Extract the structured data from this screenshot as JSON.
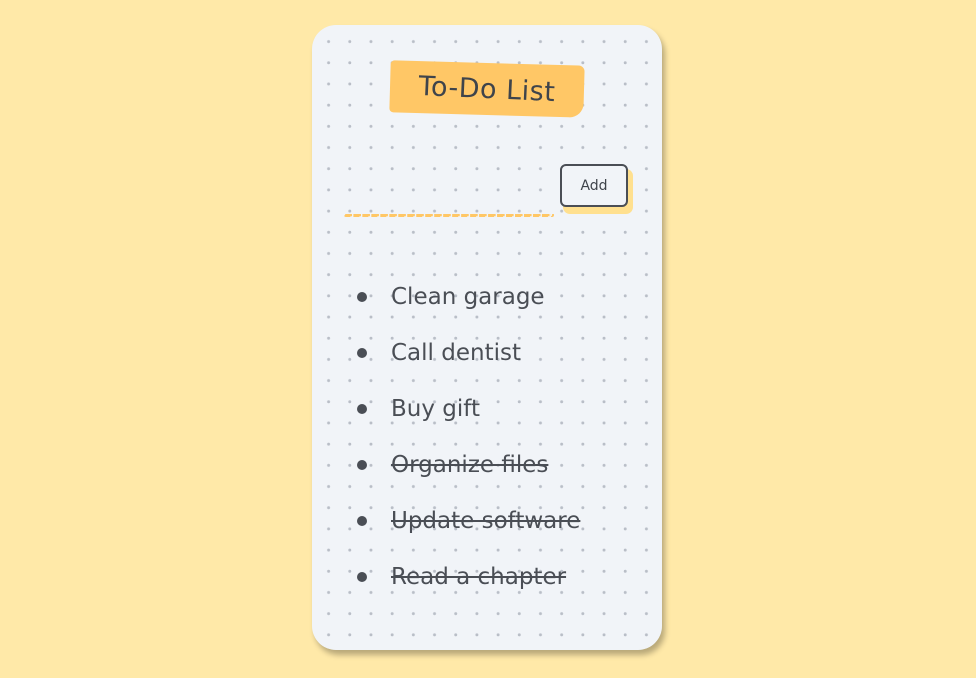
{
  "header": {
    "title": "To-Do List"
  },
  "add_form": {
    "input_value": "",
    "input_placeholder": "",
    "add_label": "Add"
  },
  "todos": [
    {
      "text": "Clean garage",
      "done": false
    },
    {
      "text": "Call dentist",
      "done": false
    },
    {
      "text": "Buy gift",
      "done": false
    },
    {
      "text": "Organize files",
      "done": true
    },
    {
      "text": "Update software",
      "done": true
    },
    {
      "text": "Read a chapter",
      "done": true
    }
  ],
  "colors": {
    "page_background": "#ffe9a8",
    "card_background": "#f1f4f8",
    "accent": "#ffc766",
    "text": "#4a4e55"
  }
}
